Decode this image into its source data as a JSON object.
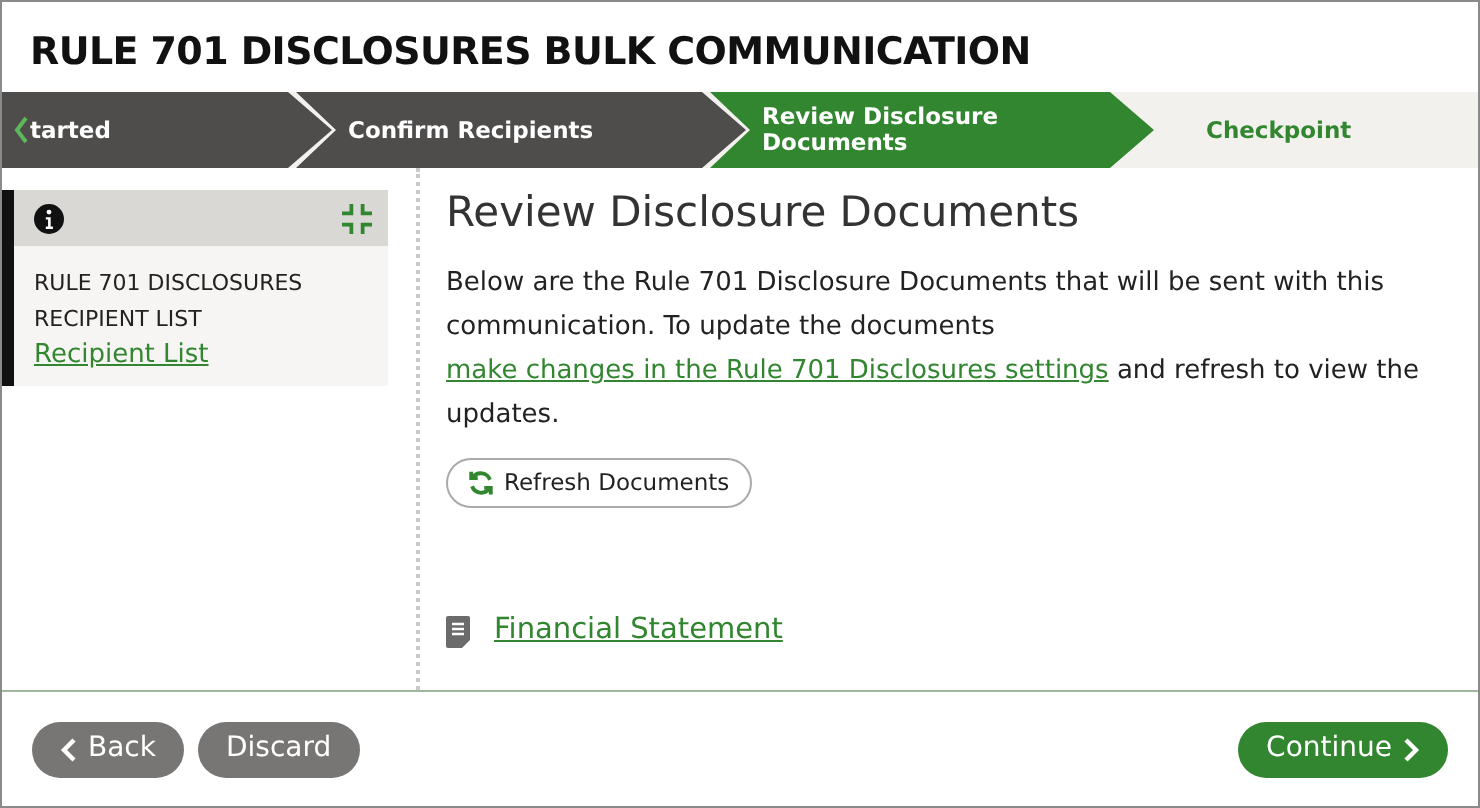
{
  "title": "RULE 701 DISCLOSURES BULK COMMUNICATION",
  "steps": [
    {
      "label": "tarted",
      "completed": true,
      "selected": false,
      "back_arrow": true
    },
    {
      "label": "Confirm Recipients",
      "completed": true,
      "selected": false,
      "back_arrow": false
    },
    {
      "label": "Review Disclosure Documents",
      "completed": false,
      "selected": true,
      "back_arrow": false
    },
    {
      "label": "Checkpoint",
      "completed": false,
      "selected": false,
      "back_arrow": false
    }
  ],
  "sidebar": {
    "heading_line_1": "RULE 701 DISCLOSURES",
    "heading_line_2": "RECIPIENT LIST",
    "link": "Recipient List"
  },
  "main": {
    "heading": "Review Disclosure Documents",
    "paragraph_before": "Below are the Rule 701 Disclosure Documents that will be sent with this communication. To update the documents ",
    "paragraph_link": "make changes in the Rule 701 Disclosures settings",
    "paragraph_after": " and refresh to view the updates.",
    "refresh_button": "Refresh Documents",
    "documents": [
      "Financial Statement"
    ]
  },
  "footer": {
    "back": "Back",
    "discard": "Discard",
    "continue": "Continue"
  }
}
